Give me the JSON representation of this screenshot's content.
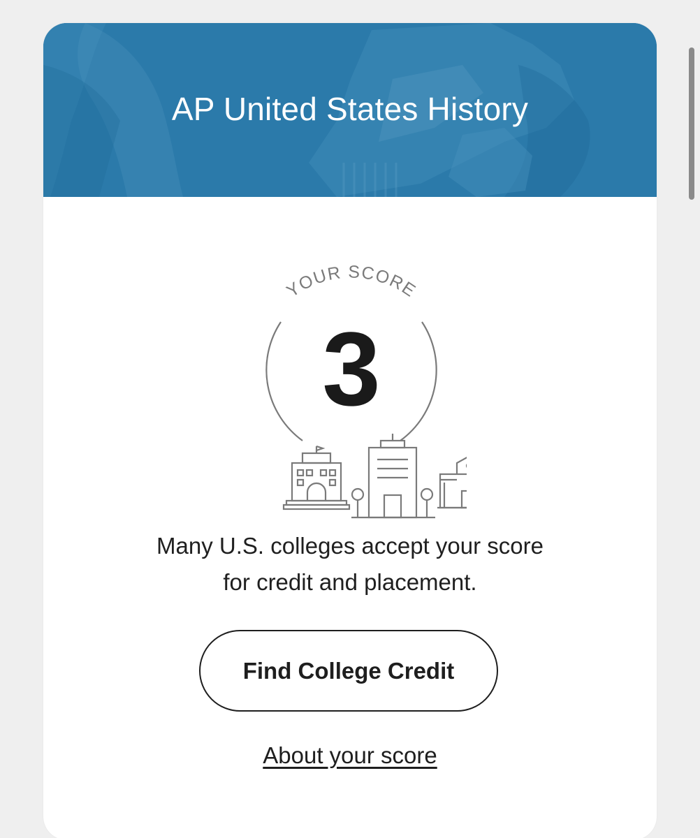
{
  "header": {
    "title": "AP United States History"
  },
  "score": {
    "label": "YOUR SCORE",
    "value": "3"
  },
  "message": "Many U.S. colleges accept your score for credit and placement.",
  "buttons": {
    "find_credit": "Find College Credit"
  },
  "links": {
    "about_score": "About your score"
  },
  "icons": {
    "hero": "statue-photo-background",
    "illustration": "college-buildings-icon"
  },
  "colors": {
    "hero_blue": "#2b7aaa",
    "text": "#1e1e1e"
  }
}
